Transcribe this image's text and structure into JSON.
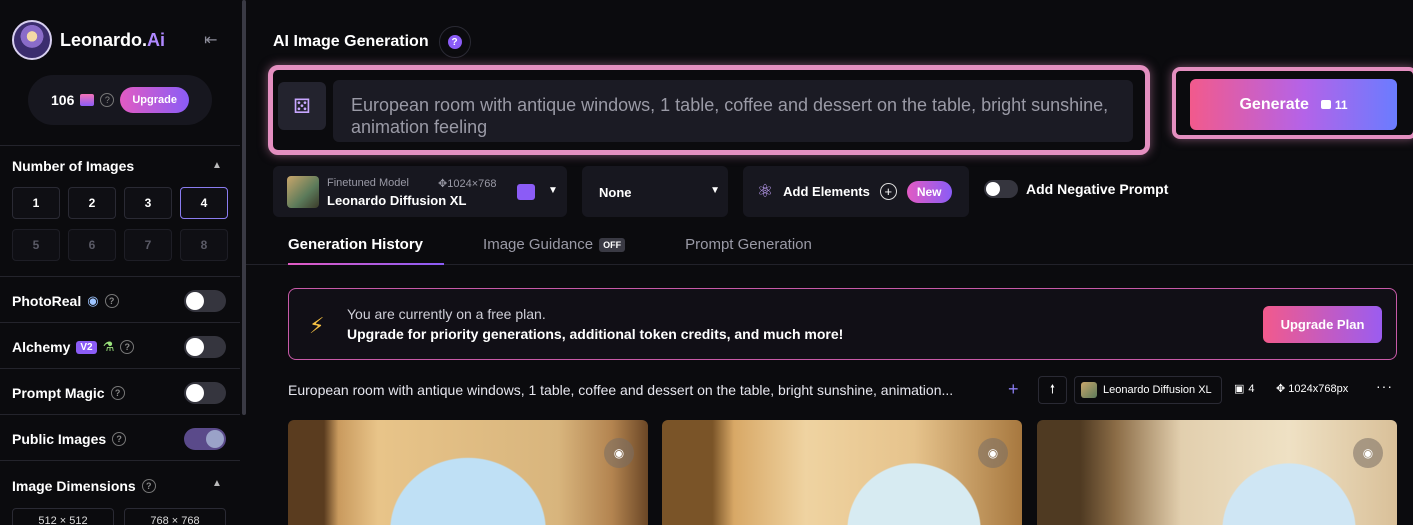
{
  "app": {
    "logo_text": "Leonardo.",
    "logo_accent": "Ai"
  },
  "sidebar": {
    "credits": "106",
    "upgrade_label": "Upgrade",
    "number_of_images": {
      "title": "Number of Images",
      "options": [
        "1",
        "2",
        "3",
        "4",
        "5",
        "6",
        "7",
        "8"
      ],
      "selected": "4"
    },
    "photoreal": {
      "label": "PhotoReal",
      "on": false
    },
    "alchemy": {
      "label": "Alchemy",
      "badge": "V2",
      "on": false
    },
    "prompt_magic": {
      "label": "Prompt Magic",
      "on": false
    },
    "public_images": {
      "label": "Public Images",
      "on": true
    },
    "image_dimensions": {
      "title": "Image Dimensions",
      "options": [
        "512 × 512",
        "768 × 768"
      ]
    }
  },
  "main": {
    "title": "AI Image Generation",
    "prompt_text": "European room with antique windows, 1 table, coffee and dessert on the table, bright sunshine, animation feeling",
    "generate": {
      "label": "Generate",
      "cost": "11"
    },
    "model": {
      "small_label": "Finetuned Model",
      "dimensions": "1024×768",
      "name": "Leonardo Diffusion XL"
    },
    "style_value": "None",
    "add_elements_label": "Add Elements",
    "new_badge": "New",
    "negative_prompt_label": "Add Negative Prompt",
    "tabs": [
      {
        "label": "Generation History",
        "active": true
      },
      {
        "label": "Image Guidance",
        "badge": "OFF"
      },
      {
        "label": "Prompt Generation"
      }
    ],
    "banner": {
      "line1": "You are currently on a free plan.",
      "line2": "Upgrade for priority generations, additional token credits, and much more!",
      "button": "Upgrade Plan"
    },
    "history": {
      "prompt": "European room with antique windows, 1 table, coffee and dessert on the table, bright sunshine, animation...",
      "model": "Leonardo Diffusion XL",
      "count": "4",
      "size": "1024x768px"
    }
  },
  "colors": {
    "accent_pink": "#e25bc3",
    "accent_purple": "#8a5cf6",
    "background": "#0b0b0e"
  }
}
